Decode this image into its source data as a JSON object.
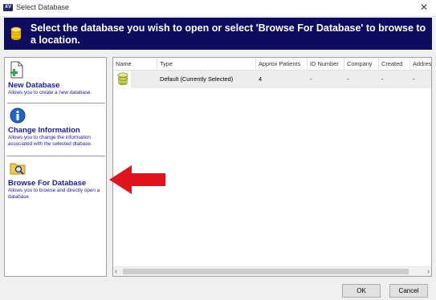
{
  "window": {
    "title": "Select Database",
    "app_icon": "XV",
    "close_glyph": "✕"
  },
  "banner": {
    "text": "Select the database you wish to open or select 'Browse For Database' to browse to a location.",
    "icon": "database-icon"
  },
  "options": [
    {
      "title": "New Database",
      "description": "Allows you to create a new database.",
      "icon": "new-database-icon"
    },
    {
      "title": "Change Information",
      "description": "Allows you to change the information associated with the selected dtabase.",
      "icon": "info-icon"
    },
    {
      "title": "Browse For Database",
      "description": "Allows you to browse and directly open a database.",
      "icon": "folder-search-icon"
    }
  ],
  "table": {
    "columns": [
      "Name",
      "Type",
      "Approx Patients",
      "ID Number",
      "Company",
      "Created",
      "Address"
    ],
    "rows": [
      {
        "icon": "database-icon",
        "type": "Default (Currently Selected)",
        "approx_patients": "4",
        "id_number": "-",
        "company": "-",
        "created": "-",
        "address": "-"
      }
    ]
  },
  "buttons": {
    "ok": "OK",
    "cancel": "Cancel"
  },
  "colors": {
    "banner_bg": "#0e0c5e",
    "link_text": "#1a1aa6",
    "annotation_arrow": "#e0141c"
  }
}
